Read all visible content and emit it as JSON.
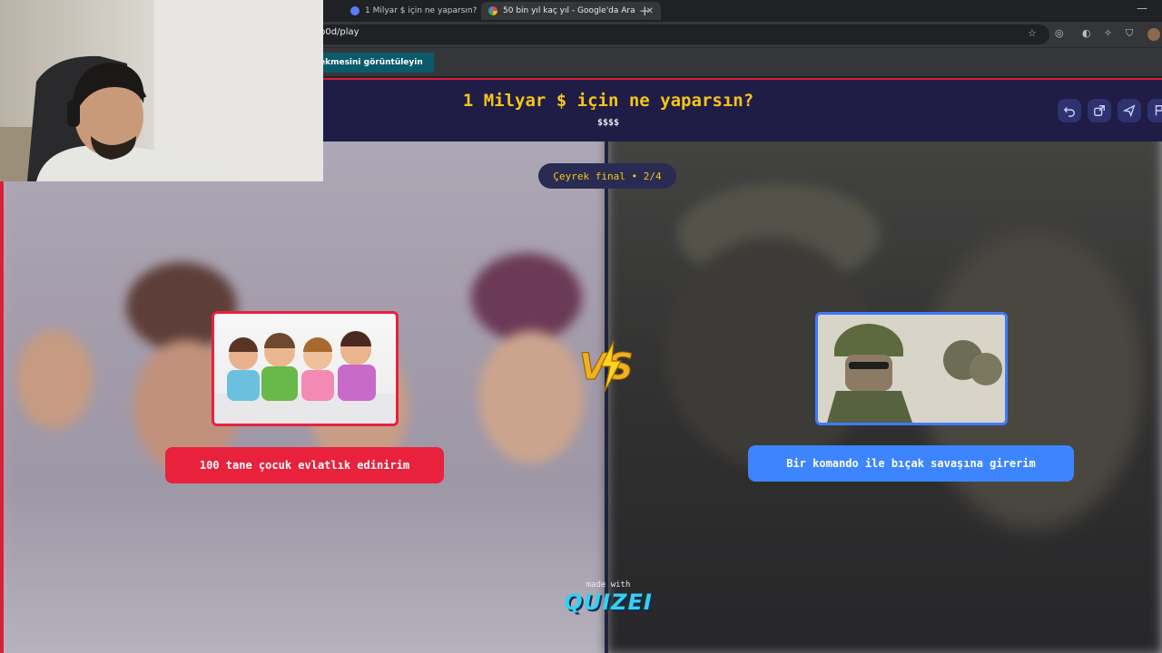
{
  "browser": {
    "tabs": [
      {
        "title": "1 Milyar $ için ne yaparsın?",
        "active": false
      },
      {
        "title": "50 bin yıl kaç yıl - Google'da Ara",
        "active": true
      }
    ],
    "url": "b0d/play",
    "bookmark_banner": "ekmesini görüntüleyin"
  },
  "quiz": {
    "title": "1 Milyar $ için ne yaparsın?",
    "subtitle": "$$$$",
    "round": "Çeyrek final • 2/4",
    "vs_label": "VS",
    "options": [
      {
        "text": "100 tane çocuk evlatlık edinirim",
        "image": "children-photo",
        "color": "#e8213c"
      },
      {
        "text": "Bir komando ile bıçak savaşına girerim",
        "image": "soldier-photo",
        "color": "#3d85ff"
      }
    ],
    "footer": {
      "made_with": "made with",
      "brand": "QUIZEI"
    }
  },
  "colors": {
    "title_yellow": "#f5c518",
    "header_bg": "#1f1d45",
    "accent_red": "#e8213c",
    "accent_blue": "#3d85ff"
  }
}
